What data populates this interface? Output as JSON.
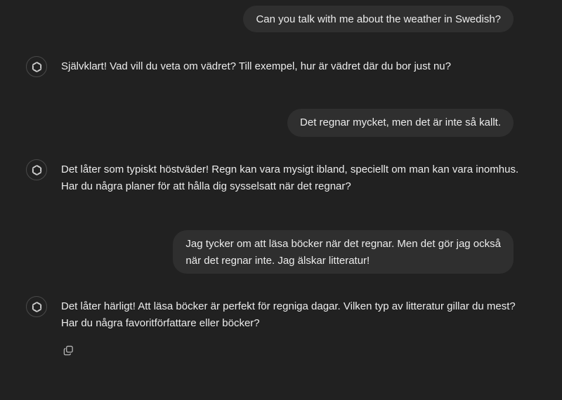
{
  "messages": [
    {
      "role": "user",
      "text": "Can you talk with me about the weather in Swedish?"
    },
    {
      "role": "assistant",
      "avatar_icon": "openai-logo-icon",
      "text": "Självklart! Vad vill du veta om vädret? Till exempel, hur är vädret där du bor just nu?"
    },
    {
      "role": "user",
      "text": "Det regnar mycket, men det är inte så kallt."
    },
    {
      "role": "assistant",
      "avatar_icon": "openai-logo-icon",
      "text": "Det låter som typiskt höstväder! Regn kan vara mysigt ibland, speciellt om man kan vara inomhus.\nHar du några planer för att hålla dig sysselsatt när det regnar?"
    },
    {
      "role": "user",
      "text": "Jag tycker om att läsa böcker när det regnar. Men det gör jag också\nnär det regnar inte. Jag älskar litteratur!"
    },
    {
      "role": "assistant",
      "avatar_icon": "openai-logo-icon",
      "text": "Det låter härligt! Att läsa böcker är perfekt för regniga dagar. Vilken typ av litteratur gillar du mest?\nHar du några favoritförfattare eller böcker?"
    }
  ],
  "actions": {
    "copy_icon": "copy-icon"
  },
  "colors": {
    "background": "#212121",
    "user_bubble": "#2f2f2f",
    "text": "#ececec"
  }
}
